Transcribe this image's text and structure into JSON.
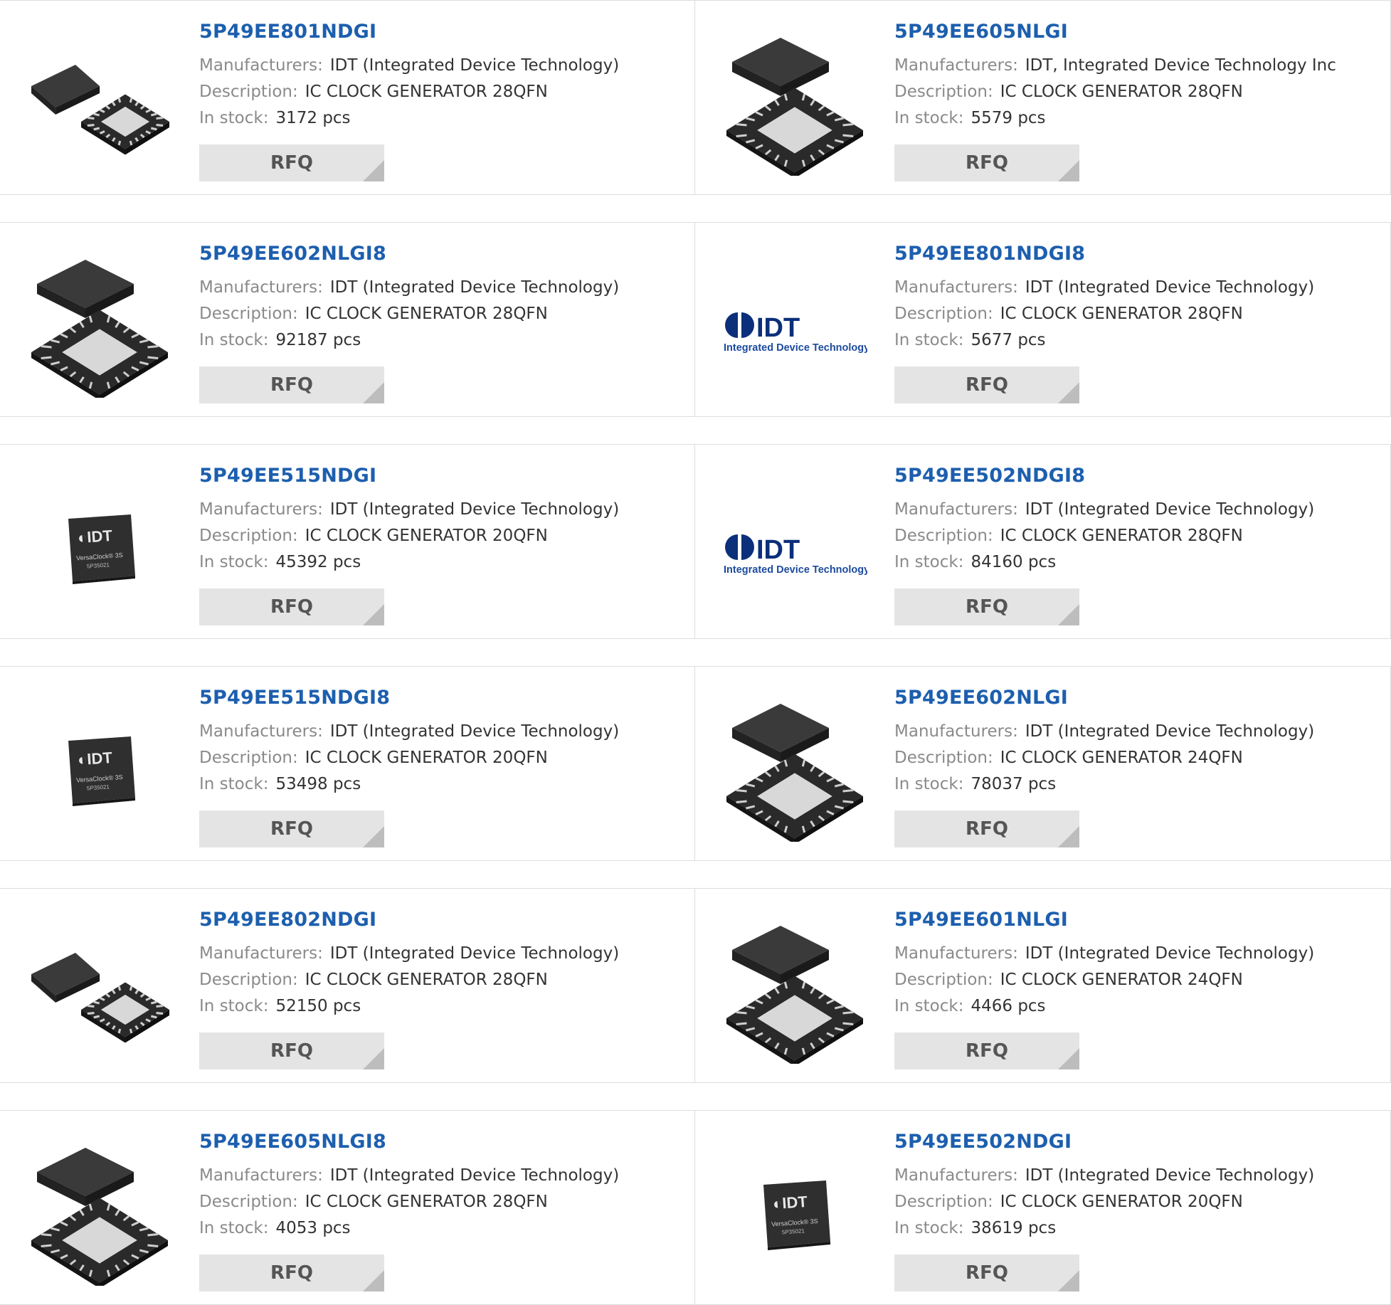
{
  "labels": {
    "manufacturers": "Manufacturers:",
    "description": "Description:",
    "in_stock": "In stock:",
    "rfq": "RFQ"
  },
  "products": [
    {
      "part": "5P49EE801NDGI",
      "manufacturer": "IDT (Integrated Device Technology)",
      "description": "IC CLOCK GENERATOR 28QFN",
      "stock": "3172 pcs",
      "image": "qfn-flat"
    },
    {
      "part": "5P49EE605NLGI",
      "manufacturer": "IDT, Integrated Device Technology Inc",
      "description": "IC CLOCK GENERATOR 28QFN",
      "stock": "5579 pcs",
      "image": "qfn-stack"
    },
    {
      "part": "5P49EE602NLGI8",
      "manufacturer": "IDT (Integrated Device Technology)",
      "description": "IC CLOCK GENERATOR 28QFN",
      "stock": "92187 pcs",
      "image": "qfn-stack"
    },
    {
      "part": "5P49EE801NDGI8",
      "manufacturer": "IDT (Integrated Device Technology)",
      "description": "IC CLOCK GENERATOR 28QFN",
      "stock": "5677 pcs",
      "image": "idt-logo"
    },
    {
      "part": "5P49EE515NDGI",
      "manufacturer": "IDT (Integrated Device Technology)",
      "description": "IC CLOCK GENERATOR 20QFN",
      "stock": "45392 pcs",
      "image": "idt-chip"
    },
    {
      "part": "5P49EE502NDGI8",
      "manufacturer": "IDT (Integrated Device Technology)",
      "description": "IC CLOCK GENERATOR 28QFN",
      "stock": "84160 pcs",
      "image": "idt-logo"
    },
    {
      "part": "5P49EE515NDGI8",
      "manufacturer": "IDT (Integrated Device Technology)",
      "description": "IC CLOCK GENERATOR 20QFN",
      "stock": "53498 pcs",
      "image": "idt-chip"
    },
    {
      "part": "5P49EE602NLGI",
      "manufacturer": "IDT (Integrated Device Technology)",
      "description": "IC CLOCK GENERATOR 24QFN",
      "stock": "78037 pcs",
      "image": "qfn-stack"
    },
    {
      "part": "5P49EE802NDGI",
      "manufacturer": "IDT (Integrated Device Technology)",
      "description": "IC CLOCK GENERATOR 28QFN",
      "stock": "52150 pcs",
      "image": "qfn-flat"
    },
    {
      "part": "5P49EE601NLGI",
      "manufacturer": "IDT (Integrated Device Technology)",
      "description": "IC CLOCK GENERATOR 24QFN",
      "stock": "4466 pcs",
      "image": "qfn-stack"
    },
    {
      "part": "5P49EE605NLGI8",
      "manufacturer": "IDT (Integrated Device Technology)",
      "description": "IC CLOCK GENERATOR 28QFN",
      "stock": "4053 pcs",
      "image": "qfn-stack"
    },
    {
      "part": "5P49EE502NDGI",
      "manufacturer": "IDT (Integrated Device Technology)",
      "description": "IC CLOCK GENERATOR 20QFN",
      "stock": "38619 pcs",
      "image": "idt-chip"
    }
  ],
  "idt_logo": {
    "brand": "IDT",
    "tagline": "Integrated Device Technology"
  },
  "chip_marking": {
    "brand": "IDT",
    "line1": "VersaClock® 3S",
    "line2": "5P35021"
  }
}
